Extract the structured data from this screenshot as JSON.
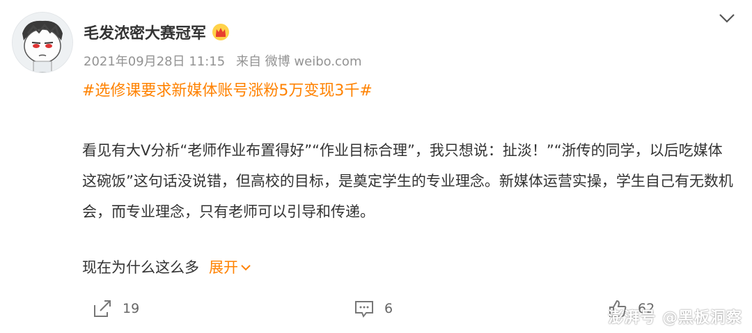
{
  "post": {
    "username": "毛发浓密大赛冠军",
    "badge_icon": "crown-icon",
    "date": "2021年09月28日 11:15",
    "source": "来自 微博 weibo.com",
    "topic": "#选修课要求新媒体账号涨粉5万变现3千#",
    "paragraph": "看见有大V分析“老师作业布置得好”“作业目标合理”，我只想说：扯淡！”“浙传的同学，以后吃媒体这碗饭”这句话没说错，但高校的目标，是奠定学生的专业理念。新媒体运营实操，学生自己有无数机会，而专业理念，只有老师可以引导和传递。",
    "last_line": "现在为什么这么多",
    "expand_label": "展开"
  },
  "actions": {
    "share_count": "19",
    "comment_count": "6",
    "like_count": "62"
  },
  "watermark": "澎湃号 @黑板洞察",
  "colors": {
    "accent": "#ff8200",
    "meta": "#939393",
    "text": "#333333"
  }
}
